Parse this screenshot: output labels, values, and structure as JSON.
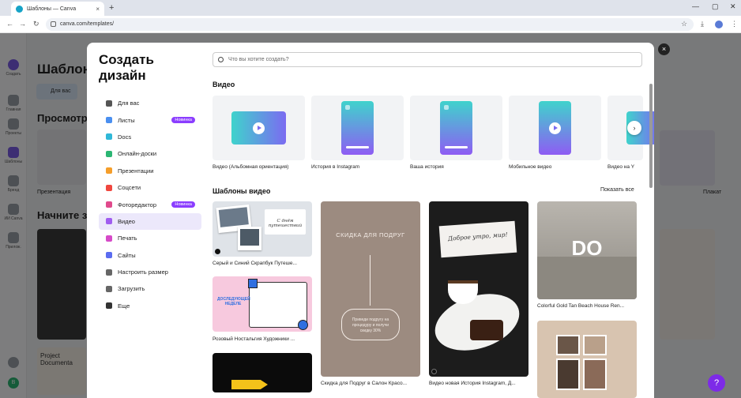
{
  "browser": {
    "tab_title": "Шаблоны — Canva",
    "tab_close": "×",
    "new_tab": "+",
    "url": "canva.com/templates/",
    "back": "←",
    "forward": "→",
    "reload": "↻",
    "minimize": "—",
    "maximize": "▢",
    "close": "✕",
    "star": "☆",
    "download": "⤓",
    "menu": "⋮"
  },
  "background": {
    "title": "Шаблоны",
    "section1": "Просмотр",
    "section2": "Начните з",
    "card_label_left": "Презентация",
    "card_label_right": "Плакат",
    "chip": "Для вас",
    "doc_text": "Project Documenta",
    "side_labels": [
      "Создать",
      "Главная",
      "Проекты",
      "Шаблоны",
      "Бренд",
      "ИИ Canva",
      "Прилож.",
      "",
      "B"
    ]
  },
  "modal": {
    "title": "Создать дизайн",
    "close": "×",
    "search_placeholder": "Что вы хотите создать?",
    "menu": [
      {
        "label": "Для вас",
        "icon": "sparkle-icon",
        "color": "#555555"
      },
      {
        "label": "Листы",
        "icon": "sheets-icon",
        "color": "#4a8ff0",
        "badge": "Новинка"
      },
      {
        "label": "Docs",
        "icon": "docs-icon",
        "color": "#30b8d8"
      },
      {
        "label": "Онлайн-доски",
        "icon": "whiteboard-icon",
        "color": "#2bb673"
      },
      {
        "label": "Презентации",
        "icon": "presentation-icon",
        "color": "#f59e2a"
      },
      {
        "label": "Соцсети",
        "icon": "social-icon",
        "color": "#f0473f"
      },
      {
        "label": "Фоторедактор",
        "icon": "photo-editor-icon",
        "color": "#e04a8c",
        "badge": "Новинка"
      },
      {
        "label": "Видео",
        "icon": "video-icon",
        "color": "#a05cf0",
        "active": true
      },
      {
        "label": "Печать",
        "icon": "print-icon",
        "color": "#d64ac8"
      },
      {
        "label": "Сайты",
        "icon": "website-icon",
        "color": "#5b6cf0"
      },
      {
        "label": "Настроить размер",
        "icon": "resize-icon",
        "color": "#666666"
      },
      {
        "label": "Загрузить",
        "icon": "upload-icon",
        "color": "#666666"
      },
      {
        "label": "Еще",
        "icon": "more-icon",
        "color": "#333333"
      }
    ],
    "video_heading": "Видео",
    "video_cards": [
      {
        "label": "Видео (Альбомная ориентация)",
        "shape": "wide"
      },
      {
        "label": "История в Instagram",
        "shape": "story"
      },
      {
        "label": "Ваша история",
        "shape": "story"
      },
      {
        "label": "Мобильное видео",
        "shape": "mobile"
      },
      {
        "label": "Видео на Y",
        "shape": "wide"
      }
    ],
    "templates_heading": "Шаблоны видео",
    "show_all": "Показать все",
    "templates": [
      {
        "label": "Серый и Синий Скрапбук Путеше...",
        "script_text": "С днём путешествий"
      },
      {
        "label": "Розовый Ностальгия Художники ...",
        "text": "ДОСЛЕДУЮЩЕЙ НЕДЕЛЕ"
      },
      {
        "label": "Скидка для Подруг в Салон Красо...",
        "text": "СКИДКА ДЛЯ ПОДРУГ",
        "subtext": "Приведи подругу на процедуру и получи скидку 30%"
      },
      {
        "label": "Видео новая История Instagram, Д...",
        "script_text": "Доброе утро, мир!"
      },
      {
        "label": "Colorful Gold Tan Beach House Ren...",
        "text": "DO"
      }
    ]
  }
}
